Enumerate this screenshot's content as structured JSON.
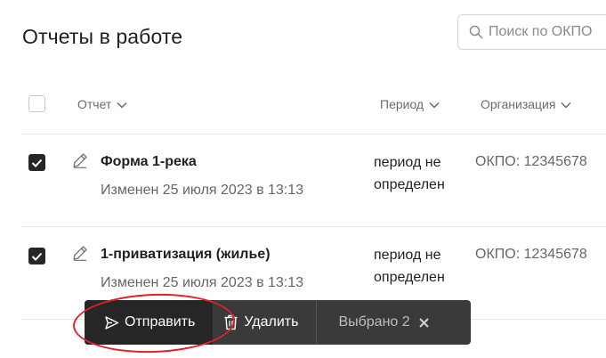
{
  "page": {
    "title": "Отчеты в работе"
  },
  "search": {
    "placeholder": "Поиск по ОКПО"
  },
  "columns": {
    "report": "Отчет",
    "period": "Период",
    "organization": "Организация"
  },
  "rows": [
    {
      "name": "Форма 1-река",
      "modified": "Изменен 25 июля 2023 в 13:13",
      "period_line1": "период не",
      "period_line2": "определен",
      "okpo": "ОКПО: 12345678",
      "checked": true
    },
    {
      "name": "1-приватизация (жилье)",
      "modified": "Изменен 25 июля 2023 в 13:13",
      "period_line1": "период не",
      "period_line2": "определен",
      "okpo": "ОКПО: 12345678",
      "checked": true
    }
  ],
  "actions": {
    "send_label": "Отправить",
    "delete_label": "Удалить",
    "selected_label": "Выбрано 2"
  },
  "colors": {
    "accent_dark": "#262626",
    "action_bar": "#3a3a3a",
    "highlight": "#e0202a"
  }
}
